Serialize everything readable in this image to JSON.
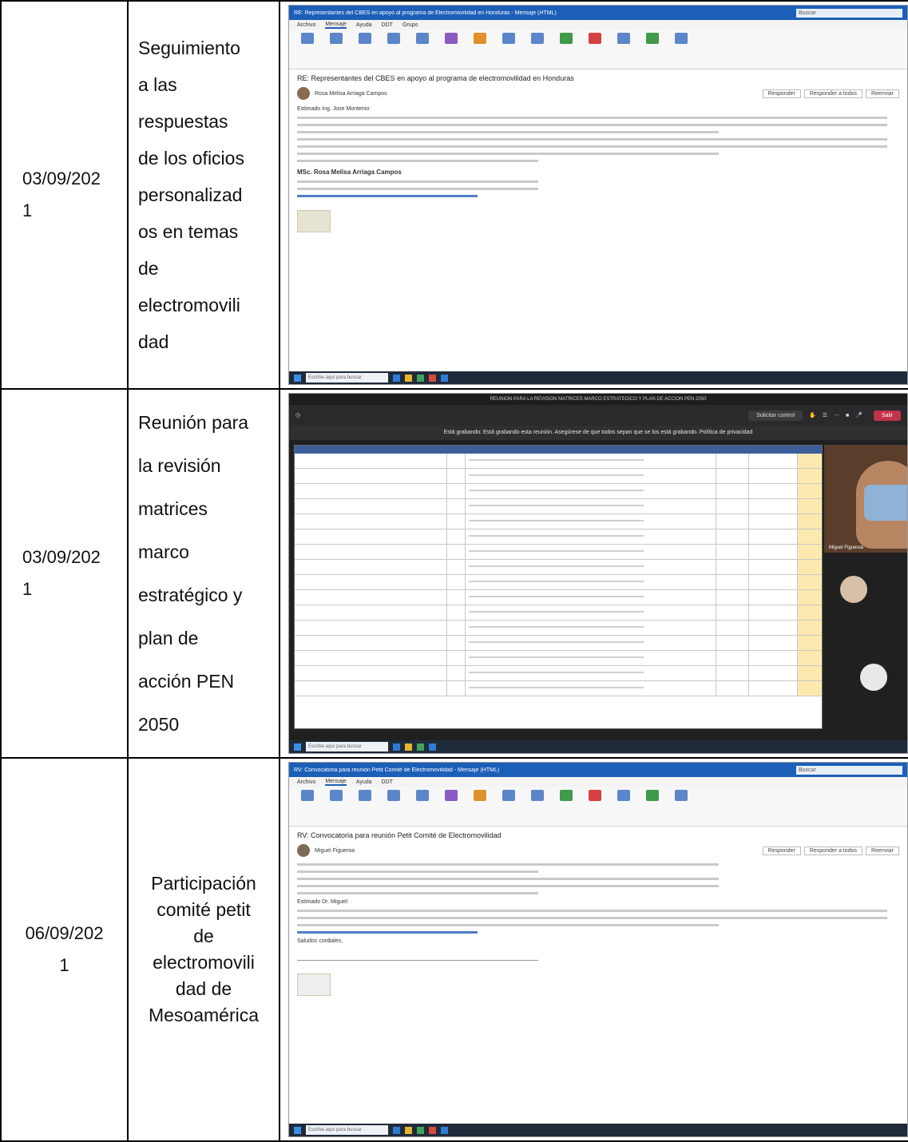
{
  "rows": [
    {
      "date": "03/09/2021",
      "activity": "Seguimiento a las respuestas de los oficios personalizados en temas de electromovilidad",
      "screenshot": {
        "app": "outlook",
        "window_title": "RE: Representantes del CBES en apoyo al programa de Electromovilidad en Honduras - Mensaje (HTML)",
        "search_placeholder": "Buscar",
        "tabs": [
          "Archivo",
          "Mensaje",
          "Ayuda",
          "DDT",
          "Grupo"
        ],
        "subject": "RE: Representantes del CBES en apoyo al programa de electromovilidad en Honduras",
        "sender": "Rosa Melisa Arriaga Campos",
        "reply_buttons": [
          "Responder",
          "Responder a todos",
          "Reenviar"
        ],
        "greeting": "Estimado Ing. Jose Montenio:",
        "signature_name": "MSc. Rosa Melisa Arriaga Campos",
        "taskbar_search": "Escribe aquí para buscar"
      }
    },
    {
      "date": "03/09/2021",
      "activity": "Reunión para la revisión matrices marco estratégico y plan de acción PEN 2050",
      "screenshot": {
        "app": "teams",
        "window_title": "REUNION PARA LA REVISION MATRICES MARCO ESTRATEGICO Y PLAN DE ACCION PEN 2050",
        "control_button": "Solicitar control",
        "leave_button": "Salir",
        "recording_banner": "Está grabando: Está grabando esta reunión. Asegúrese de que todos sepan que se los está grabando. Política de privacidad",
        "participant": "Miguel Figueroa",
        "taskbar_search": "Escribe aquí para buscar"
      }
    },
    {
      "date": "06/09/2021",
      "activity": "Participación comité petit de electromovilidad de Mesoamérica",
      "screenshot": {
        "app": "outlook",
        "window_title": "RV: Convocatoria para reunión Petit Comité de Electromovilidad - Mensaje (HTML)",
        "search_placeholder": "Buscar",
        "tabs": [
          "Archivo",
          "Mensaje",
          "Ayuda",
          "DDT"
        ],
        "subject": "RV: Convocatoria para reunión Petit Comité de Electromovilidad",
        "sender": "Miguel Figueroa",
        "reply_buttons": [
          "Responder",
          "Responder a todos",
          "Reenviar"
        ],
        "greeting": "Estimado Dr. Miguel:",
        "closing": "Saludos cordiales,",
        "taskbar_search": "Escribe aquí para buscar"
      }
    }
  ],
  "display_text": {
    "row0_date_a": "03/09/202",
    "row0_date_b": "1",
    "row0_act": [
      "Seguimiento",
      "a las",
      "respuestas",
      "de los oficios",
      "personalizad",
      "os en temas",
      "de",
      "electromovili",
      "dad"
    ],
    "row1_date_a": "03/09/202",
    "row1_date_b": "1",
    "row1_act": [
      "Reunión para",
      "la revisión",
      "matrices",
      "marco",
      "estratégico y",
      "plan de",
      "acción PEN",
      "2050"
    ],
    "row2_date_a": "06/09/202",
    "row2_date_b": "1",
    "row2_act": [
      "Participación",
      "comité petit",
      "de",
      "electromovili",
      "dad de",
      "Mesoamérica"
    ]
  }
}
